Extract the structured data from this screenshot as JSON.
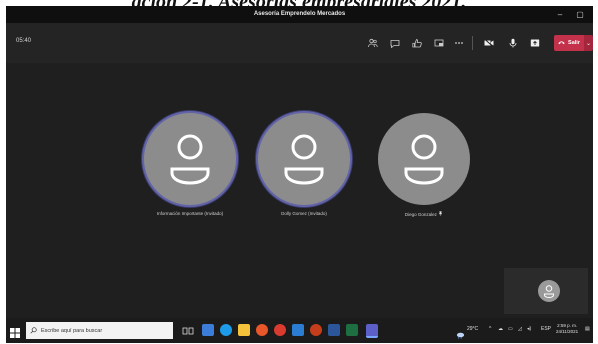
{
  "caption": "ación 2-1. Asesorías empresariales 2021.",
  "window": {
    "title": "Asesoría Emprendelo Mercados",
    "minimize_glyph": "–",
    "maximize_glyph": "▢"
  },
  "toolbar": {
    "timer": "05:40",
    "icons": [
      "participants-icon",
      "chat-icon",
      "reactions-icon",
      "rooms-icon",
      "more-icon",
      "camera-icon",
      "mic-icon",
      "share-icon"
    ],
    "leave_label": "Salir",
    "leave_dropdown": "⌄",
    "leave_color": "#c4314b"
  },
  "participants": [
    {
      "name": "Información Importante (Invitado)",
      "speaking": true
    },
    {
      "name": "Dolly Gomez (Invitado)",
      "speaking": true
    },
    {
      "name": "Diego Gonzalez",
      "speaking": false,
      "pinned": true
    }
  ],
  "taskbar": {
    "search_placeholder": "Escribe aquí para buscar",
    "weather": "29°C",
    "lang": "ESP",
    "time": "2:59 p. m.",
    "date": "24/11/2021"
  },
  "colors": {
    "accent": "#6264a7",
    "app_bg": "#1f1f1f"
  }
}
